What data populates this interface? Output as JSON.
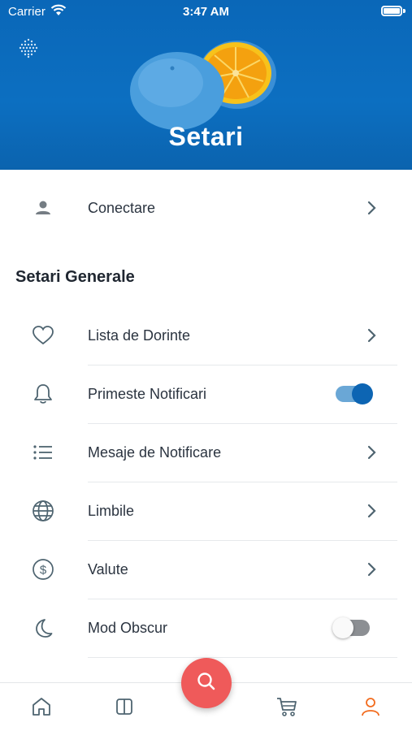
{
  "status_bar": {
    "carrier": "Carrier",
    "time": "3:47 AM"
  },
  "header": {
    "title": "Setari"
  },
  "login_row": {
    "label": "Conectare",
    "icon": "person-icon"
  },
  "general_section": {
    "title": "Setari Generale",
    "items": [
      {
        "label": "Lista de Dorinte",
        "icon": "heart-icon",
        "control": "chevron"
      },
      {
        "label": "Primeste Notificari",
        "icon": "bell-icon",
        "control": "toggle",
        "toggle_on": true
      },
      {
        "label": "Mesaje de Notificare",
        "icon": "list-icon",
        "control": "chevron"
      },
      {
        "label": "Limbile",
        "icon": "globe-icon",
        "control": "chevron"
      },
      {
        "label": "Valute",
        "icon": "dollar-icon",
        "control": "chevron"
      },
      {
        "label": "Mod Obscur",
        "icon": "moon-icon",
        "control": "toggle",
        "toggle_on": false
      }
    ]
  },
  "bottom_nav": {
    "items": [
      "home-icon",
      "layout-icon",
      "search-icon",
      "cart-icon",
      "user-icon"
    ],
    "active": "user-icon",
    "active_color": "#f26b1d"
  },
  "colors": {
    "header_blue": "#0c6fc1",
    "toggle_on": "#0d65b3",
    "fab": "#ef5a5a",
    "icon": "#4e6470"
  }
}
